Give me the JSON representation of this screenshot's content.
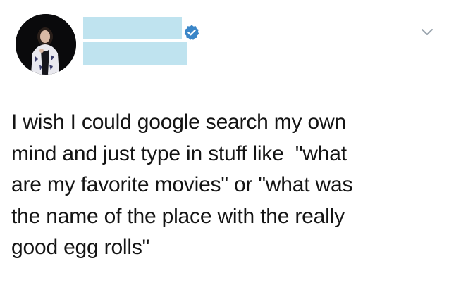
{
  "header": {
    "avatar_icon": "profile-photo-avatar",
    "verified_icon": "verified-check-icon",
    "caret_icon": "chevron-down-icon",
    "redaction_color": "#bfe3ef",
    "verified_color": "#3a86c8"
  },
  "tweet": {
    "lines": [
      "I wish I could google search my own",
      "mind and just type in stuff like  \"what",
      "are my favorite movies\" or \"what was",
      "the name of the place with the really",
      "good egg rolls\""
    ]
  }
}
